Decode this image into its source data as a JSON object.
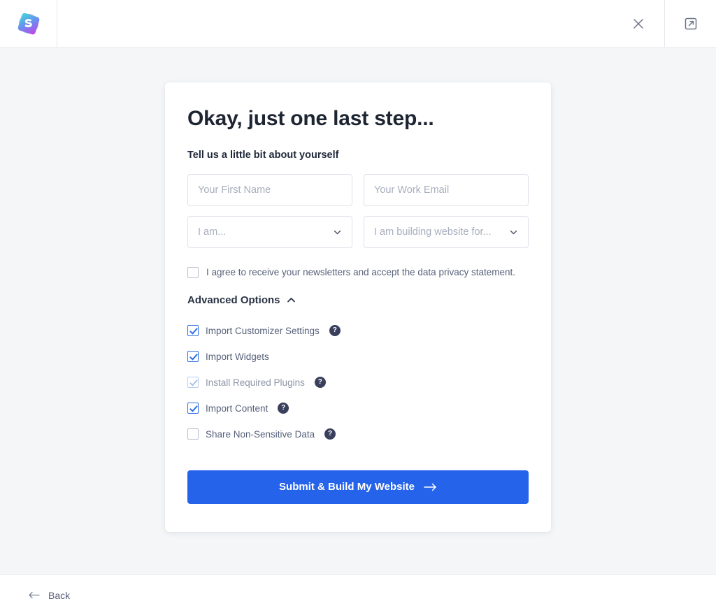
{
  "header": {
    "logo_name": "starter-templates-logo",
    "close_label": "close-icon",
    "external_label": "external-link-icon",
    "logo_gradient_from": "#3edcd6",
    "logo_gradient_to": "#c93ee8"
  },
  "card": {
    "title": "Okay, just one last step...",
    "subtitle": "Tell us a little bit about yourself",
    "fields": {
      "first_name": {
        "placeholder": "Your First Name",
        "value": ""
      },
      "work_email": {
        "placeholder": "Your Work Email",
        "value": ""
      },
      "role_select": {
        "selected": "I am..."
      },
      "purpose_select": {
        "selected": "I am building website for..."
      }
    },
    "consent": {
      "label": "I agree to receive your newsletters and accept the data privacy statement.",
      "checked": false
    },
    "advanced": {
      "label": "Advanced Options",
      "expanded": true,
      "options": [
        {
          "label": "Import Customizer Settings",
          "checked": true,
          "disabled": false,
          "help": true
        },
        {
          "label": "Import Widgets",
          "checked": true,
          "disabled": false,
          "help": false
        },
        {
          "label": "Install Required Plugins",
          "checked": true,
          "disabled": true,
          "help": true
        },
        {
          "label": "Import Content",
          "checked": true,
          "disabled": false,
          "help": true
        },
        {
          "label": "Share Non-Sensitive Data",
          "checked": false,
          "disabled": false,
          "help": true
        }
      ],
      "help_glyph": "?"
    },
    "submit": {
      "label": "Submit & Build My Website",
      "color": "#2563eb"
    }
  },
  "footer": {
    "back_label": "Back"
  }
}
